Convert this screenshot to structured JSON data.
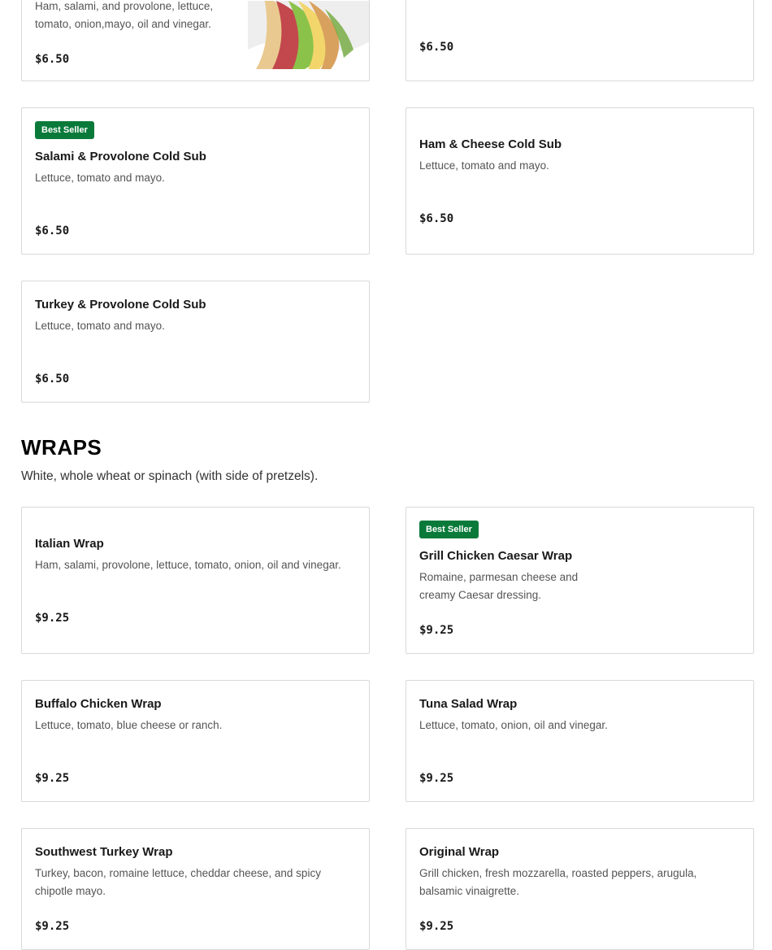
{
  "items": {
    "italian_sub": {
      "description": "Ham, salami, and provolone, lettuce, tomato, onion,mayo, oil and vinegar.",
      "price": "$6.50",
      "image_icon": "sandwich-photo"
    },
    "top_right": {
      "price": "$6.50"
    },
    "salami_provolone": {
      "badge": "Best Seller",
      "name": "Salami & Provolone Cold Sub",
      "description": "Lettuce, tomato and mayo.",
      "price": "$6.50"
    },
    "ham_cheese": {
      "name": "Ham & Cheese Cold Sub",
      "description": "Lettuce, tomato and mayo.",
      "price": "$6.50"
    },
    "turkey_provolone": {
      "name": "Turkey & Provolone Cold Sub",
      "description": "Lettuce, tomato and mayo.",
      "price": "$6.50"
    }
  },
  "wraps_section": {
    "title": "WRAPS",
    "subtitle": "White, whole wheat or spinach (with side of pretzels).",
    "items": {
      "italian_wrap": {
        "name": "Italian Wrap",
        "description": "Ham, salami, provolone, lettuce, tomato, onion, oil and vinegar.",
        "price": "$9.25"
      },
      "grill_chicken_caesar": {
        "badge": "Best Seller",
        "name": "Grill Chicken Caesar Wrap",
        "description_line1": "Romaine, parmesan cheese and",
        "description_line2": "creamy Caesar dressing.",
        "price": "$9.25"
      },
      "buffalo_chicken": {
        "name": "Buffalo Chicken Wrap",
        "description": "Lettuce, tomato, blue cheese or ranch.",
        "price": "$9.25"
      },
      "tuna_salad": {
        "name": "Tuna Salad Wrap",
        "description": "Lettuce, tomato, onion, oil and vinegar.",
        "price": "$9.25"
      },
      "southwest_turkey": {
        "name": "Southwest Turkey Wrap",
        "description": "Turkey, bacon, romaine lettuce, cheddar cheese, and spicy chipotle mayo.",
        "price": "$9.25"
      },
      "original": {
        "name": "Original Wrap",
        "description": "Grill chicken, fresh mozzarella, roasted peppers, arugula, balsamic vinaigrette.",
        "price": "$9.25"
      }
    }
  },
  "colors": {
    "badge_green": "#0a7a3a",
    "card_border": "#d9d9d9",
    "description_gray": "#545454"
  }
}
